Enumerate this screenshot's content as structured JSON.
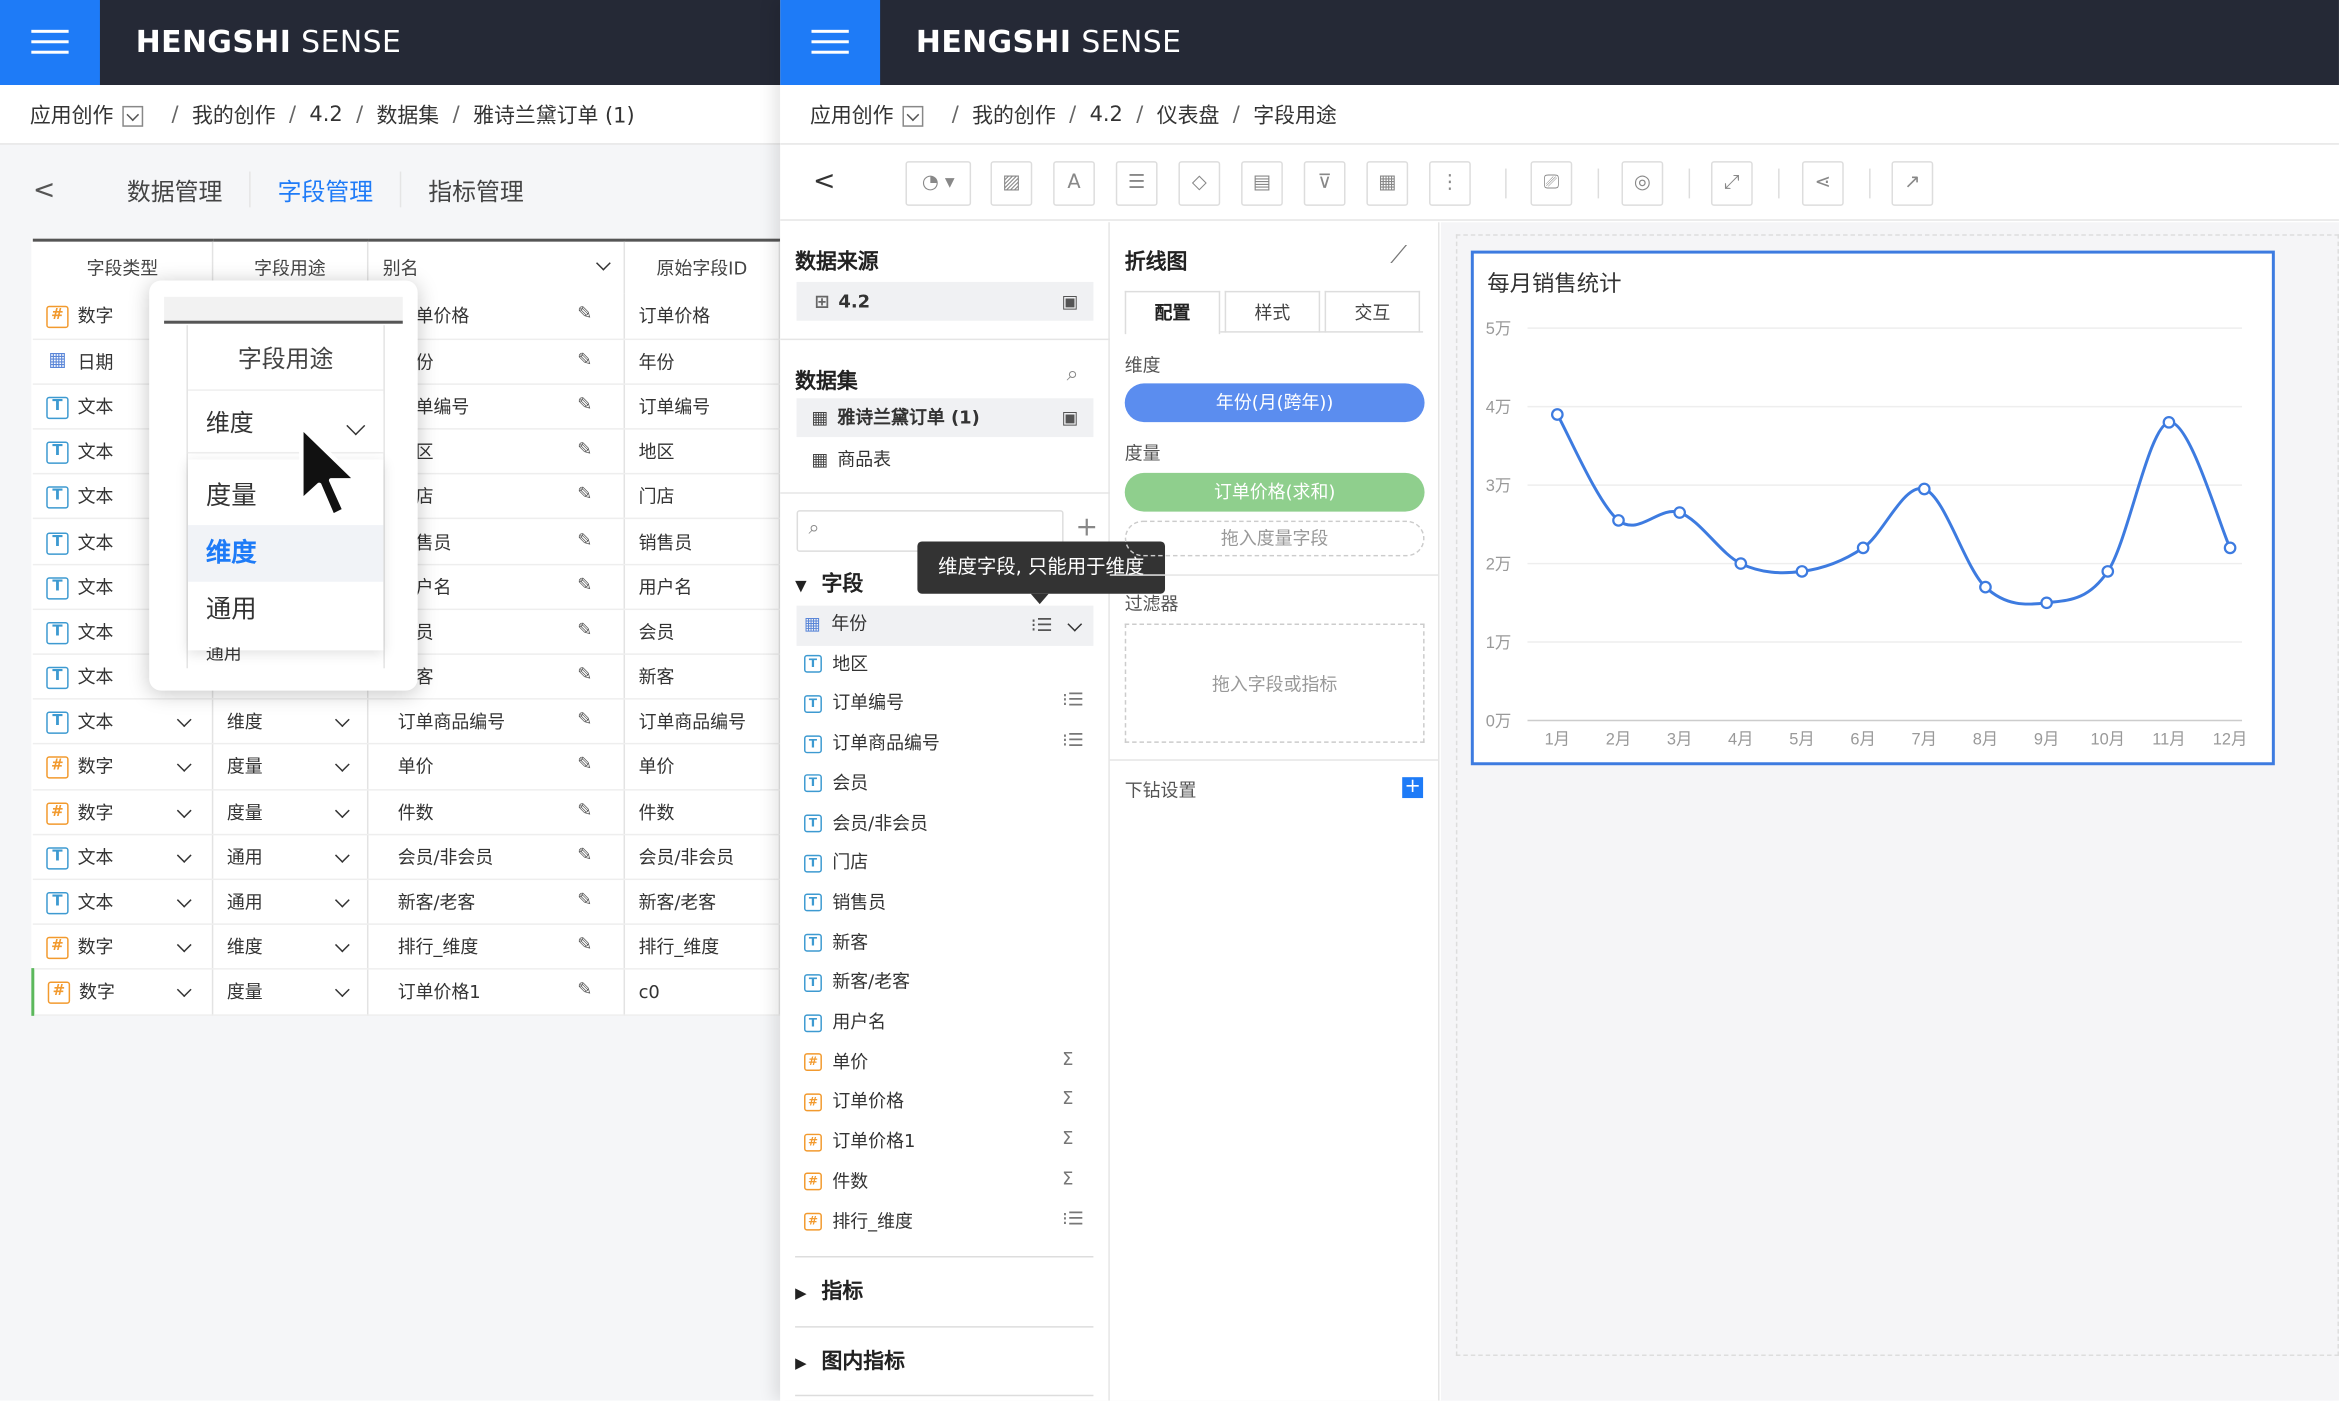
{
  "brand": {
    "name_bold": "HENGSHI",
    "name_rest": " SENSE"
  },
  "left": {
    "breadcrumb": [
      "应用创作",
      "我的创作",
      "4.2",
      "数据集",
      "雅诗兰黛订单 (1)"
    ],
    "tabs": [
      "数据管理",
      "字段管理",
      "指标管理"
    ],
    "table": {
      "headers": [
        "字段类型",
        "字段用途",
        "别名",
        "原始字段ID"
      ],
      "rows": [
        {
          "type": "数字",
          "usage": "",
          "alias": "订单价格",
          "id": "订单价格"
        },
        {
          "type": "日期",
          "usage": "",
          "alias": "年份",
          "id": "年份"
        },
        {
          "type": "文本",
          "usage": "",
          "alias": "订单编号",
          "id": "订单编号"
        },
        {
          "type": "文本",
          "usage": "",
          "alias": "地区",
          "id": "地区"
        },
        {
          "type": "文本",
          "usage": "",
          "alias": "门店",
          "id": "门店"
        },
        {
          "type": "文本",
          "usage": "",
          "alias": "销售员",
          "id": "销售员"
        },
        {
          "type": "文本",
          "usage": "",
          "alias": "用户名",
          "id": "用户名"
        },
        {
          "type": "文本",
          "usage": "",
          "alias": "会员",
          "id": "会员"
        },
        {
          "type": "文本",
          "usage": "",
          "alias": "新客",
          "id": "新客"
        },
        {
          "type": "文本",
          "usage": "维度",
          "alias": "订单商品编号",
          "id": "订单商品编号"
        },
        {
          "type": "数字",
          "usage": "度量",
          "alias": "单价",
          "id": "单价"
        },
        {
          "type": "数字",
          "usage": "度量",
          "alias": "件数",
          "id": "件数"
        },
        {
          "type": "文本",
          "usage": "通用",
          "alias": "会员/非会员",
          "id": "会员/非会员"
        },
        {
          "type": "文本",
          "usage": "通用",
          "alias": "新客/老客",
          "id": "新客/老客"
        },
        {
          "type": "数字",
          "usage": "维度",
          "alias": "排行_维度",
          "id": "排行_维度"
        },
        {
          "type": "数字",
          "usage": "度量",
          "alias": "订单价格1",
          "id": "c0"
        }
      ]
    },
    "popup": {
      "header": "字段用途",
      "selected": "维度",
      "options": [
        "度量",
        "维度",
        "通用"
      ],
      "bottom_value": "通用"
    }
  },
  "right": {
    "breadcrumb": [
      "应用创作",
      "我的创作",
      "4.2",
      "仪表盘",
      "字段用途"
    ],
    "datasource": {
      "title": "数据来源",
      "value": "4.2"
    },
    "dataset": {
      "title": "数据集",
      "items": [
        "雅诗兰黛订单 (1)",
        "商品表"
      ]
    },
    "fields_title": "字段",
    "tooltip": "维度字段, 只能用于维度",
    "fields": [
      {
        "name": "年份",
        "kind": "date"
      },
      {
        "name": "地区",
        "kind": "text"
      },
      {
        "name": "订单编号",
        "kind": "text"
      },
      {
        "name": "订单商品编号",
        "kind": "text"
      },
      {
        "name": "会员",
        "kind": "text"
      },
      {
        "name": "会员/非会员",
        "kind": "text"
      },
      {
        "name": "门店",
        "kind": "text"
      },
      {
        "name": "销售员",
        "kind": "text"
      },
      {
        "name": "新客",
        "kind": "text"
      },
      {
        "name": "新客/老客",
        "kind": "text"
      },
      {
        "name": "用户名",
        "kind": "text"
      },
      {
        "name": "单价",
        "kind": "num"
      },
      {
        "name": "订单价格",
        "kind": "num"
      },
      {
        "name": "订单价格1",
        "kind": "num"
      },
      {
        "name": "件数",
        "kind": "num"
      },
      {
        "name": "排行_维度",
        "kind": "num"
      }
    ],
    "indicators_title": "指标",
    "chart_indicators_title": "图内指标",
    "config": {
      "chart_type": "折线图",
      "tabs": [
        "配置",
        "样式",
        "交互"
      ],
      "dimension_label": "维度",
      "dimension_value": "年份(月(跨年))",
      "measure_label": "度量",
      "measure_value": "订单价格(求和)",
      "measure_drop": "拖入度量字段",
      "filter_label": "过滤器",
      "filter_drop": "拖入字段或指标",
      "drill_label": "下钻设置"
    }
  },
  "colors": {
    "topbar": "#252936",
    "accent": "#1e7bf7",
    "dimension_pill": "#5b8def",
    "measure_pill": "#8fcf8d",
    "line": "#3d7be0"
  },
  "chart_data": {
    "type": "line",
    "title": "每月销售统计",
    "categories": [
      "1月",
      "2月",
      "3月",
      "4月",
      "5月",
      "6月",
      "7月",
      "8月",
      "9月",
      "10月",
      "11月",
      "12月"
    ],
    "values": [
      3.9,
      2.55,
      2.65,
      2.0,
      1.9,
      2.2,
      2.95,
      1.7,
      1.5,
      1.9,
      3.8,
      2.2
    ],
    "y_ticks": [
      "0万",
      "1万",
      "2万",
      "3万",
      "4万",
      "5万"
    ],
    "ylim": [
      0,
      5
    ],
    "grid": true,
    "smooth": true
  }
}
